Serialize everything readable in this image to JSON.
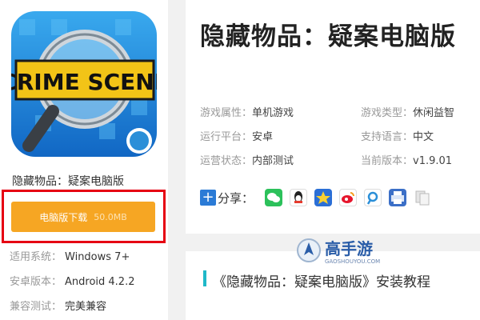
{
  "app": {
    "icon_text": "CRIME SCENE",
    "name": "隐藏物品：疑案电脑版",
    "download": {
      "label": "电脑版下载",
      "size": "50.0MB"
    },
    "specs": [
      {
        "label": "适用系统：",
        "value": "Windows 7+"
      },
      {
        "label": "安卓版本：",
        "value": "Android 4.2.2"
      },
      {
        "label": "兼容测试：",
        "value": "完美兼容"
      }
    ]
  },
  "detail": {
    "title": "隐藏物品：疑案电脑版",
    "info": [
      {
        "label": "游戏属性：",
        "value": "单机游戏"
      },
      {
        "label": "游戏类型：",
        "value": "休闲益智"
      },
      {
        "label": "运行平台：",
        "value": "安卓"
      },
      {
        "label": "支持语言：",
        "value": "中文"
      },
      {
        "label": "运营状态：",
        "value": "内部测试"
      },
      {
        "label": "当前版本：",
        "value": "v1.9.01"
      }
    ],
    "share_label": "分享："
  },
  "tutorial": {
    "title": "《隐藏物品：疑案电脑版》安装教程"
  },
  "brand": {
    "name": "高手游",
    "domain": "GAOSHOUYOU.COM"
  },
  "colors": {
    "download_button": "#f6a623",
    "highlight_border": "#e60012",
    "accent": "#1fb8c8"
  }
}
